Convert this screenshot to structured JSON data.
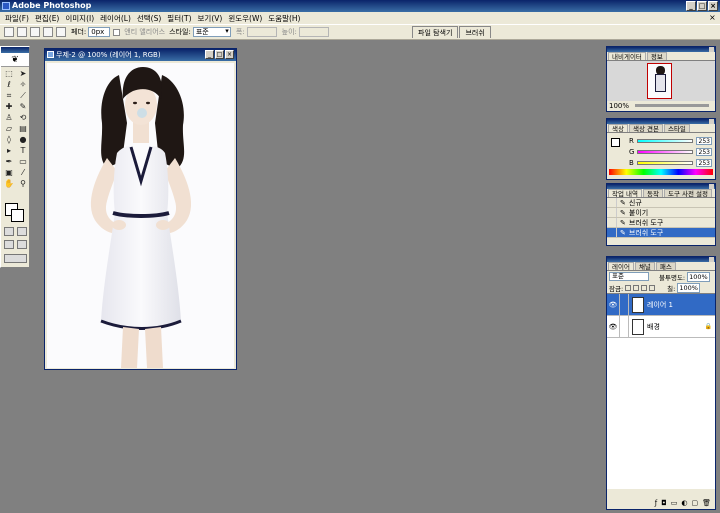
{
  "app": {
    "title": "Adobe Photoshop"
  },
  "menu": [
    "파일(F)",
    "편집(E)",
    "이미지(I)",
    "레이어(L)",
    "선택(S)",
    "필터(T)",
    "보기(V)",
    "윈도우(W)",
    "도움말(H)"
  ],
  "options": {
    "feather_label": "페더:",
    "feather_value": "0px",
    "antialias_label": "앤티 앨리어스",
    "style_label": "스타일:",
    "style_value": "표준",
    "width_label": "폭:",
    "height_label": "높이:"
  },
  "palette_well": [
    "파일 탐색기",
    "브러쉬"
  ],
  "document": {
    "title": "무제-2 @ 100% (레이어 1, RGB)"
  },
  "navigator": {
    "tabs": [
      "내비게이터",
      "정보"
    ],
    "zoom": "100%"
  },
  "color": {
    "tabs": [
      "색상",
      "색상 견본",
      "스타일"
    ],
    "channels": [
      {
        "label": "R",
        "value": "253"
      },
      {
        "label": "G",
        "value": "253"
      },
      {
        "label": "B",
        "value": "253"
      }
    ]
  },
  "history": {
    "tabs": [
      "작업 내역",
      "동작",
      "도구 사전 설정"
    ],
    "items": [
      "신규",
      "붙이기",
      "브러쉬 도구",
      "브러쉬 도구"
    ],
    "selected_index": 3
  },
  "layers": {
    "tabs": [
      "레이어",
      "채널",
      "패스"
    ],
    "blend_mode": "표준",
    "opacity_label": "불투명도:",
    "opacity_value": "100%",
    "lock_label": "잠금:",
    "fill_label": "칠:",
    "fill_value": "100%",
    "items": [
      {
        "name": "레이어 1",
        "selected": true
      },
      {
        "name": "배경",
        "selected": false
      }
    ]
  },
  "colors": {
    "titlebar_start": "#0a246a",
    "titlebar_end": "#3a6ea5",
    "workspace": "#808080",
    "chrome": "#ece9d8",
    "selection": "#316ac5"
  }
}
